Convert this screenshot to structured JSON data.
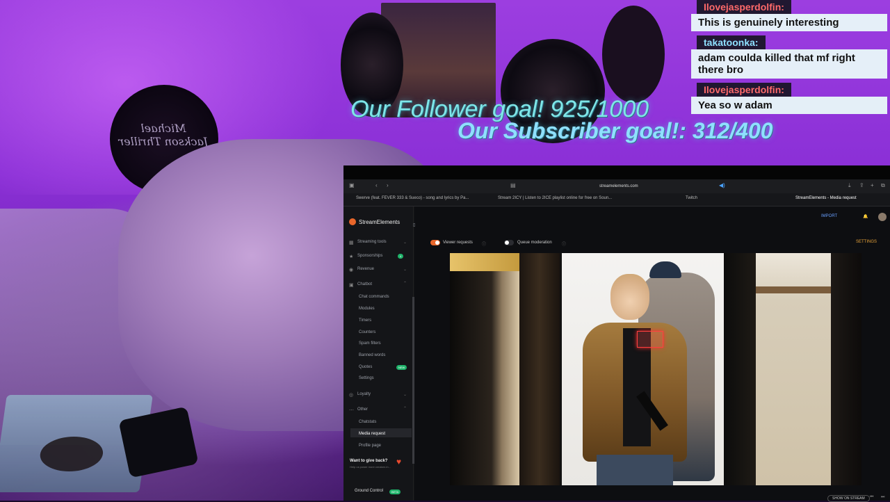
{
  "overlay": {
    "follower_goal": "Our Follower goal! 925/1000",
    "subscriber_goal": "Our Subscriber goal!: 312/400",
    "poster_text": "Michael Jackson Thriller"
  },
  "chat": [
    {
      "user": "Ilovejasperdolfin:",
      "message": "This is genuinely interesting",
      "user_color": "#ff6a6a"
    },
    {
      "user": "takatoonka:",
      "message": "adam coulda killed that mf right there bro",
      "user_color": "#8ee0ff"
    },
    {
      "user": "Ilovejasperdolfin:",
      "message": "Yea so w adam",
      "user_color": "#ff6a6a"
    }
  ],
  "browser": {
    "url": "streamelements.com",
    "tabs": [
      "Swerve (feat. FEVER 333 & Sueco) - song and lyrics by Pa...",
      "Stream 2ICY | Listen to 2ICE playlist online for free on Soun...",
      "Twitch",
      "StreamElements - Media request"
    ]
  },
  "sidebar": {
    "brand": "StreamElements",
    "items": [
      {
        "label": "Streaming tools",
        "kind": "section"
      },
      {
        "label": "Sponsorships",
        "kind": "section",
        "badge": "4"
      },
      {
        "label": "Revenue",
        "kind": "section"
      },
      {
        "label": "Chatbot",
        "kind": "section"
      },
      {
        "label": "Chat commands",
        "kind": "sub"
      },
      {
        "label": "Modules",
        "kind": "sub"
      },
      {
        "label": "Timers",
        "kind": "sub"
      },
      {
        "label": "Counters",
        "kind": "sub"
      },
      {
        "label": "Spam filters",
        "kind": "sub"
      },
      {
        "label": "Banned words",
        "kind": "sub"
      },
      {
        "label": "Quotes",
        "kind": "sub",
        "badge": "NEW"
      },
      {
        "label": "Settings",
        "kind": "sub"
      },
      {
        "label": "Loyalty",
        "kind": "section"
      },
      {
        "label": "Other",
        "kind": "section"
      },
      {
        "label": "Chatstats",
        "kind": "sub"
      },
      {
        "label": "Media request",
        "kind": "sub",
        "active": true
      },
      {
        "label": "Profile page",
        "kind": "sub"
      }
    ],
    "give_title": "Want to give back?",
    "give_sub": "Help us power more creators in...",
    "ground_control": "Ground Control",
    "ground_badge": "BETA"
  },
  "main": {
    "import_label": "IMPORT",
    "settings_label": "SETTINGS",
    "viewer_requests_label": "Viewer requests",
    "viewer_requests_on": true,
    "queue_moderation_label": "Queue moderation",
    "queue_moderation_on": false,
    "show_on_stream": "SHOW ON STREAM"
  },
  "colors": {
    "accent_orange": "#e8662a",
    "settings_orange": "#e8a33a",
    "import_blue": "#6aa0ff",
    "badge_green": "#1fb36a",
    "goal_cyan": "#7fe6e8"
  }
}
